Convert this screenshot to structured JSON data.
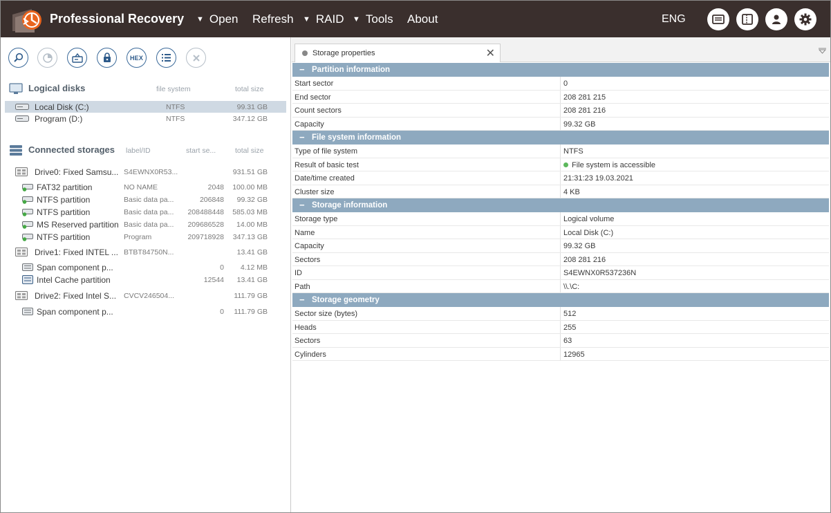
{
  "app": {
    "title": "Professional Recovery"
  },
  "menu": {
    "open": "Open",
    "refresh": "Refresh",
    "raid": "RAID",
    "tools": "Tools",
    "about": "About",
    "lang": "ENG"
  },
  "toolbar_icons": [
    "search-icon",
    "chart-icon",
    "image-icon",
    "lock-icon",
    "hex-icon",
    "list-icon",
    "close-icon"
  ],
  "toolbar_hex_label": "HEX",
  "logical": {
    "heading": "Logical disks",
    "col_fs": "file system",
    "col_size": "total size",
    "items": [
      {
        "name": "Local Disk (C:)",
        "fs": "NTFS",
        "size": "99.31 GB"
      },
      {
        "name": "Program (D:)",
        "fs": "NTFS",
        "size": "347.12 GB"
      }
    ]
  },
  "storages": {
    "heading": "Connected storages",
    "col_label": "label/ID",
    "col_start": "start se...",
    "col_size": "total size",
    "items": [
      {
        "name": "Drive0: Fixed Samsu...",
        "label": "S4EWNX0R53...",
        "start": "",
        "size": "931.51 GB"
      },
      {
        "name": "FAT32 partition",
        "label": "NO NAME",
        "start": "2048",
        "size": "100.00 MB"
      },
      {
        "name": "NTFS partition",
        "label": "Basic data pa...",
        "start": "206848",
        "size": "99.32 GB"
      },
      {
        "name": "NTFS partition",
        "label": "Basic data pa...",
        "start": "208488448",
        "size": "585.03 MB"
      },
      {
        "name": "MS Reserved partition",
        "label": "Basic data pa...",
        "start": "209686528",
        "size": "14.00 MB"
      },
      {
        "name": "NTFS partition",
        "label": "Program",
        "start": "209718928",
        "size": "347.13 GB"
      },
      {
        "name": "Drive1: Fixed INTEL ...",
        "label": "BTBT84750N...",
        "start": "",
        "size": "13.41 GB"
      },
      {
        "name": "Span component p...",
        "label": "",
        "start": "0",
        "size": "4.12 MB"
      },
      {
        "name": "Intel Cache partition",
        "label": "",
        "start": "12544",
        "size": "13.41 GB"
      },
      {
        "name": "Drive2: Fixed Intel S...",
        "label": "CVCV246504...",
        "start": "",
        "size": "111.79 GB"
      },
      {
        "name": "Span component p...",
        "label": "",
        "start": "0",
        "size": "111.79 GB"
      }
    ]
  },
  "tab": {
    "title": "Storage properties"
  },
  "groups": [
    {
      "title": "Partition information",
      "rows": [
        {
          "k": "Start sector",
          "v": "0"
        },
        {
          "k": "End sector",
          "v": "208 281 215"
        },
        {
          "k": "Count sectors",
          "v": "208 281 216"
        },
        {
          "k": "Capacity",
          "v": "99.32 GB"
        }
      ]
    },
    {
      "title": "File system information",
      "rows": [
        {
          "k": "Type of file system",
          "v": "NTFS"
        },
        {
          "k": "Result of basic test",
          "v": "File system is accessible"
        },
        {
          "k": "Date/time created",
          "v": "21:31:23 19.03.2021"
        },
        {
          "k": "Cluster size",
          "v": "4 KB"
        }
      ]
    },
    {
      "title": "Storage information",
      "rows": [
        {
          "k": "Storage type",
          "v": "Logical volume"
        },
        {
          "k": "Name",
          "v": "Local Disk (C:)"
        },
        {
          "k": "Capacity",
          "v": "99.32 GB"
        },
        {
          "k": "Sectors",
          "v": "208 281 216"
        },
        {
          "k": "ID",
          "v": "S4EWNX0R537236N"
        },
        {
          "k": "Path",
          "v": "\\\\.\\C:"
        }
      ]
    },
    {
      "title": "Storage geometry",
      "rows": [
        {
          "k": "Sector size (bytes)",
          "v": "512"
        },
        {
          "k": "Heads",
          "v": "255"
        },
        {
          "k": "Sectors",
          "v": "63"
        },
        {
          "k": "Cylinders",
          "v": "12965"
        }
      ]
    }
  ],
  "colors": {
    "topbar": "#3a2f2d",
    "group_header": "#8ea9bf",
    "selection": "#cfd9e3",
    "accent": "#e8641e",
    "status_ok": "#5cb85c"
  }
}
